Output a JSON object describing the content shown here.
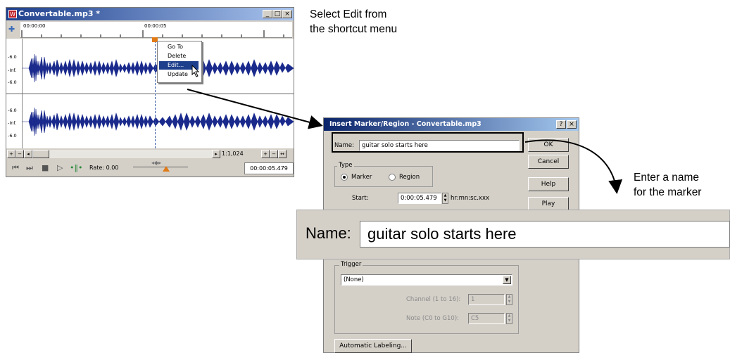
{
  "editor": {
    "title": "Convertable.mp3 *",
    "icon": "app-icon",
    "ruler": {
      "start": "00:00:00",
      "mid": "00:00:05"
    },
    "track_scale": [
      "-6.0",
      "-Inf.",
      "-6.0",
      "-6.0",
      "-Inf.",
      "-6.0"
    ],
    "context_menu": {
      "items": [
        "Go To",
        "Delete",
        "Edit...",
        "Update"
      ],
      "selected": "Edit..."
    },
    "zoom_ratio": "1:1,024",
    "rate": "Rate: 0.00",
    "time": "00:00:05.479"
  },
  "captions": {
    "top_line1": "Select Edit from",
    "top_line2": "the shortcut menu",
    "right_line1": "Enter a name",
    "right_line2": "for the marker"
  },
  "dialog": {
    "title": "Insert Marker/Region - Convertable.mp3",
    "help_glyph": "?",
    "close_glyph": "×",
    "name_label": "Name:",
    "name_value": "guitar solo starts here",
    "buttons": {
      "ok": "OK",
      "cancel": "Cancel",
      "help": "Help",
      "play": "Play"
    },
    "type_group": {
      "legend": "Type",
      "options": [
        "Marker",
        "Region"
      ],
      "selected": "Marker"
    },
    "start_label": "Start:",
    "start_value": "0:00:05.479",
    "start_units": "hr:mn:sc.xxx",
    "trigger_group": {
      "legend": "Trigger",
      "select_value": "(None)",
      "channel_label": "Channel (1 to 16):",
      "channel_value": "1",
      "note_label": "Note (C0 to G10):",
      "note_value": "C5"
    },
    "auto_label_button": "Automatic Labeling..."
  },
  "zoom_callout": {
    "label": "Name:",
    "value": "guitar solo starts here"
  }
}
